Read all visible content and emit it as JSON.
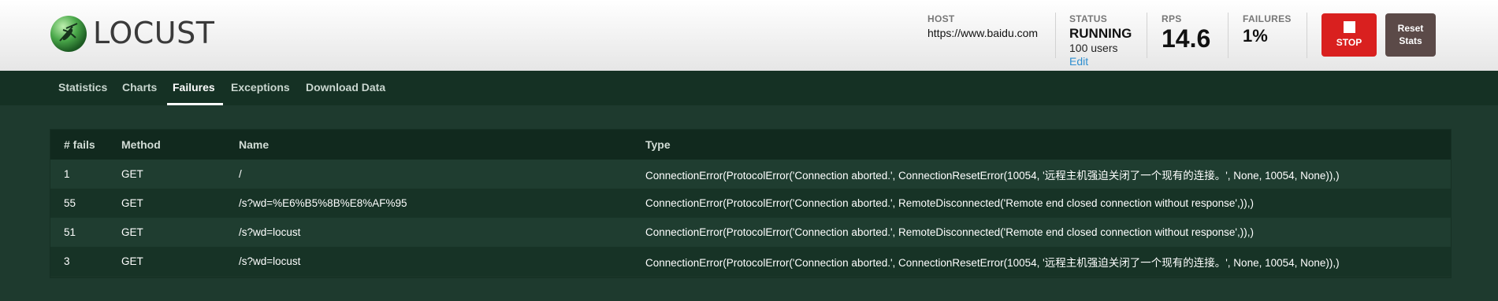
{
  "header": {
    "logo_text": "LOCUST",
    "host": {
      "label": "HOST",
      "value": "https://www.baidu.com"
    },
    "status": {
      "label": "STATUS",
      "value": "RUNNING",
      "users": "100 users",
      "edit": "Edit"
    },
    "rps": {
      "label": "RPS",
      "value": "14.6"
    },
    "failures": {
      "label": "FAILURES",
      "value": "1%"
    },
    "stop_button": "STOP",
    "reset_button_line1": "Reset",
    "reset_button_line2": "Stats"
  },
  "tabs": [
    {
      "label": "Statistics"
    },
    {
      "label": "Charts"
    },
    {
      "label": "Failures"
    },
    {
      "label": "Exceptions"
    },
    {
      "label": "Download Data"
    }
  ],
  "active_tab": "Failures",
  "failures_table": {
    "columns": [
      "# fails",
      "Method",
      "Name",
      "Type"
    ],
    "rows": [
      [
        "1",
        "GET",
        "/",
        "ConnectionError(ProtocolError('Connection aborted.', ConnectionResetError(10054, '远程主机强迫关闭了一个现有的连接。', None, 10054, None)),)"
      ],
      [
        "55",
        "GET",
        "/s?wd=%E6%B5%8B%E8%AF%95",
        "ConnectionError(ProtocolError('Connection aborted.', RemoteDisconnected('Remote end closed connection without response',)),)"
      ],
      [
        "51",
        "GET",
        "/s?wd=locust",
        "ConnectionError(ProtocolError('Connection aborted.', RemoteDisconnected('Remote end closed connection without response',)),)"
      ],
      [
        "3",
        "GET",
        "/s?wd=locust",
        "ConnectionError(ProtocolError('Connection aborted.', ConnectionResetError(10054, '远程主机强迫关闭了一个现有的连接。', None, 10054, None)),)"
      ]
    ]
  },
  "colors": {
    "background": "#1e3a2e",
    "tab_bar": "#153124",
    "stop": "#d9201f",
    "reset": "#5b4a48",
    "edit_link": "#2f8fd0"
  }
}
